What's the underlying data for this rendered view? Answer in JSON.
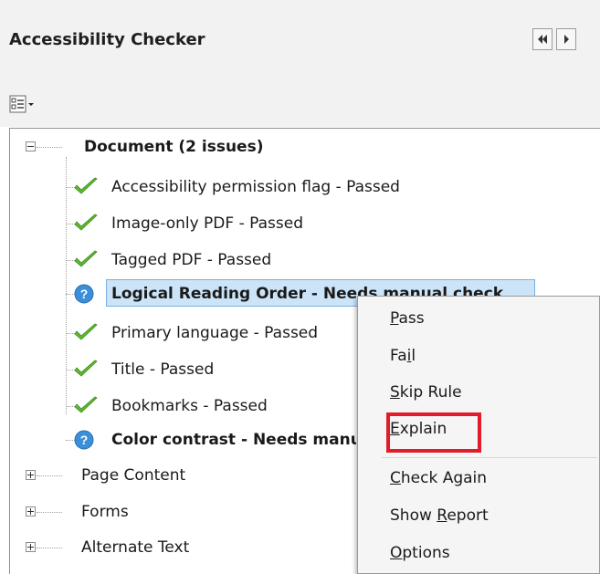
{
  "panel": {
    "title": "Accessibility Checker"
  },
  "tree": {
    "root": {
      "label": "Document (2 issues)",
      "children": [
        {
          "label": "Accessibility permission flag - Passed",
          "status": "passed"
        },
        {
          "label": "Image-only PDF - Passed",
          "status": "passed"
        },
        {
          "label": "Tagged PDF - Passed",
          "status": "passed"
        },
        {
          "label": "Logical Reading Order - Needs manual check",
          "status": "needs-check"
        },
        {
          "label": "Primary language - Passed",
          "status": "passed"
        },
        {
          "label": "Title - Passed",
          "status": "passed"
        },
        {
          "label": "Bookmarks - Passed",
          "status": "passed"
        },
        {
          "label": "Color contrast - Needs manual check",
          "status": "needs-check"
        }
      ]
    },
    "sections": [
      {
        "label": "Page Content"
      },
      {
        "label": "Forms"
      },
      {
        "label": "Alternate Text"
      }
    ]
  },
  "context_menu": {
    "items": [
      {
        "pre": "",
        "key": "P",
        "post": "ass"
      },
      {
        "pre": "Fa",
        "key": "i",
        "post": "l"
      },
      {
        "pre": "",
        "key": "S",
        "post": "kip Rule"
      },
      {
        "pre": "",
        "key": "E",
        "post": "xplain"
      },
      {
        "pre": "",
        "key": "C",
        "post": "heck Again"
      },
      {
        "pre": "Show ",
        "key": "R",
        "post": "eport"
      },
      {
        "pre": "",
        "key": "O",
        "post": "ptions"
      }
    ]
  },
  "colors": {
    "check": "#5cb82e",
    "help": "#3a8fd8",
    "highlight": "#e21b2a",
    "selection": "#cce4f7"
  }
}
